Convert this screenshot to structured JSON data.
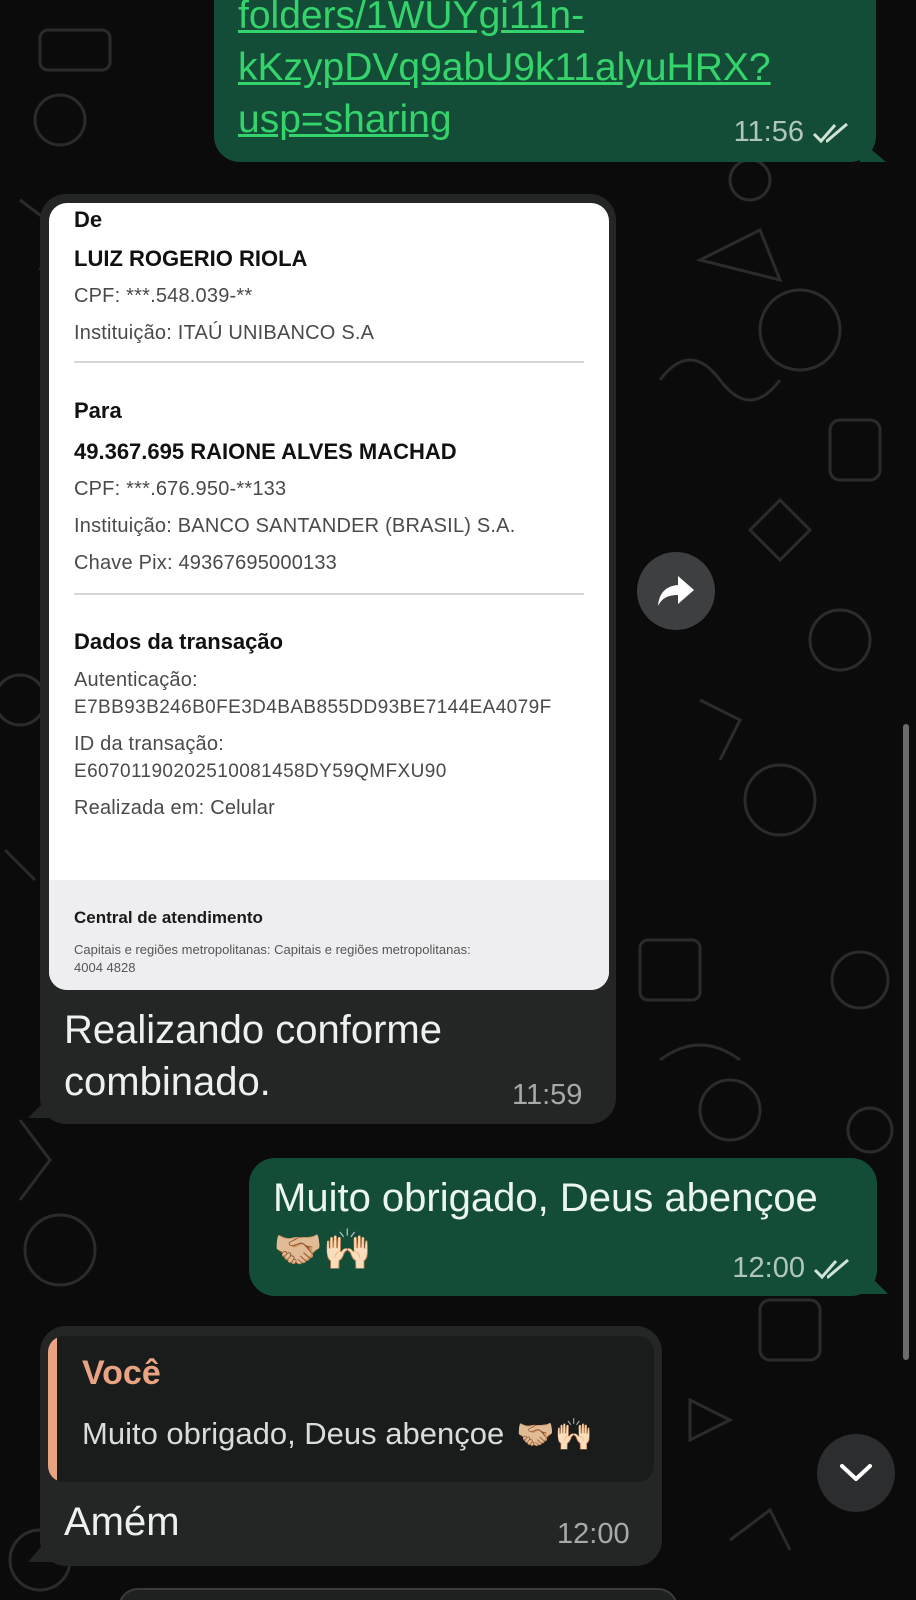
{
  "messages": {
    "link_message": {
      "line1": "folders/1WUYgi11n-",
      "line2": "kKzypDVq9abU9k11alyuHRX?",
      "line3": "usp=sharing",
      "time": "11:56"
    },
    "receipt_message": {
      "receipt": {
        "from_heading": "De",
        "from_name": "LUIZ ROGERIO RIOLA",
        "from_cpf": "CPF:  ***.548.039-**",
        "from_institution": "Instituição:  ITAÚ UNIBANCO S.A",
        "to_heading": "Para",
        "to_name": "49.367.695 RAIONE ALVES MACHAD",
        "to_cpf": "CPF:  ***.676.950-**133",
        "to_institution": "Instituição:  BANCO SANTANDER (BRASIL) S.A.",
        "to_pix_key": "Chave Pix:  49367695000133",
        "tx_heading": "Dados da transação",
        "auth_label": "Autenticação:",
        "auth_value": "E7BB93B246B0FE3D4BAB855DD93BE7144EA4079F",
        "txid_label": "ID da transação:",
        "txid_value": "E60701190202510081458DY59QMFXU90",
        "done_on": "Realizada em:  Celular",
        "footer_title": "Central de atendimento",
        "footer_line1": "Capitais e regiões metropolitanas:  Capitais e regiões metropolitanas:",
        "footer_line2": "4004 4828"
      },
      "text_line1": "Realizando conforme",
      "text_line2": "combinado.",
      "time": "11:59"
    },
    "thanks_message": {
      "text": "Muito obrigado, Deus abençoe",
      "emojis": "🤝🏼🙌🏻",
      "time": "12:00"
    },
    "reply_message": {
      "quote_author": "Você",
      "quote_text": "Muito obrigado, Deus abençoe",
      "quote_emojis": "🤝🏼🙌🏻",
      "text": "Amém",
      "time": "12:00"
    }
  },
  "icons": {
    "forward": "forward-icon",
    "scroll_down": "chevron-down-icon",
    "read_receipt": "double-check-icon"
  },
  "colors": {
    "outgoing_bubble": "#144d37",
    "incoming_bubble": "#242626",
    "link": "#35d36c",
    "quote_author": "#e8a383",
    "background": "#0b0b0b"
  }
}
